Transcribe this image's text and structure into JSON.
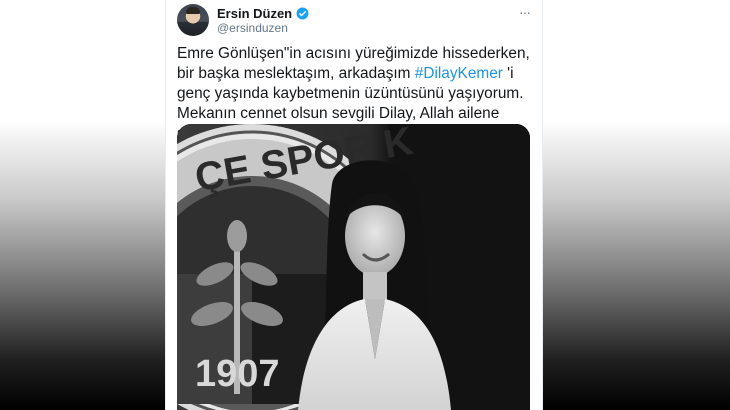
{
  "tweet": {
    "author_name": "Ersin Düzen",
    "author_handle": "@ersinduzen",
    "more_menu": "···",
    "text_part1": "Emre Gönlüşen\"in acısını yüreğimizde hissederken, bir başka meslektaşım, arkadaşım ",
    "hashtag": "#DilayKemer",
    "text_part2": " 'i genç yaşında kaybetmenin üzüntüsünü yaşıyorum. Mekanın cennet olsun sevgili Dilay, Allah ailene sabır versin..."
  },
  "media": {
    "badge_arc_text": "ÇE SPOR K",
    "badge_year": "1907"
  },
  "icons": {
    "verified": "verified-badge-icon",
    "more": "more-options-icon"
  },
  "colors": {
    "hashtag": "#1b95e0",
    "verified": "#1da1f2",
    "text": "#14171a",
    "secondary": "#657786"
  }
}
